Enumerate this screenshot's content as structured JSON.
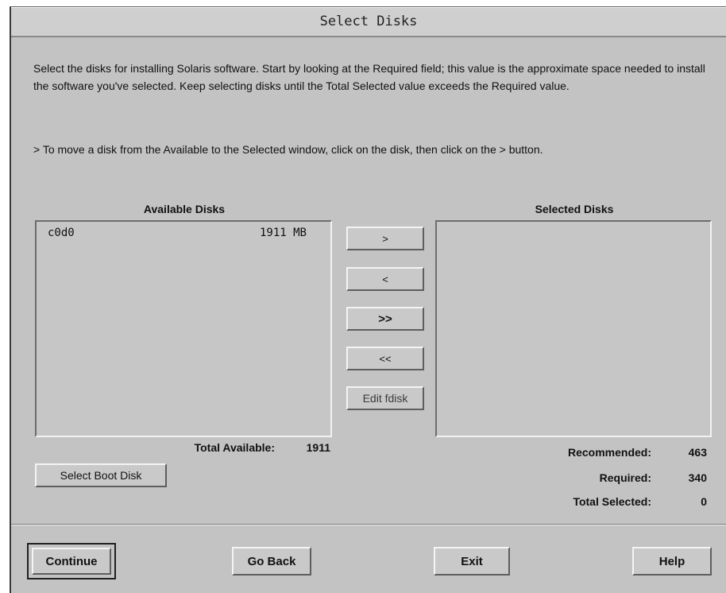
{
  "window": {
    "title": "Select Disks"
  },
  "instructions": {
    "paragraph1": "Select the disks for installing Solaris software. Start by looking at the Required field; this value is the approximate space needed to install the software you've selected. Keep selecting disks until the Total Selected value exceeds the Required value.",
    "paragraph2": "> To move a disk from the Available to the Selected window, click on the disk, then click on the > button."
  },
  "available": {
    "title": "Available Disks",
    "disks": [
      {
        "name": "c0d0",
        "size": "1911 MB"
      }
    ],
    "total_label": "Total Available:",
    "total_value": "1911"
  },
  "selected": {
    "title": "Selected Disks",
    "disks": []
  },
  "transfer_buttons": {
    "add": ">",
    "remove": "<",
    "add_all": ">>",
    "remove_all": "<<",
    "edit_fdisk": "Edit fdisk"
  },
  "select_boot_disk": "Select Boot Disk",
  "stats": {
    "recommended_label": "Recommended:",
    "recommended_value": "463",
    "required_label": "Required:",
    "required_value": "340",
    "total_selected_label": "Total Selected:",
    "total_selected_value": "0"
  },
  "footer": {
    "continue": "Continue",
    "go_back": "Go Back",
    "exit": "Exit",
    "help": "Help"
  }
}
